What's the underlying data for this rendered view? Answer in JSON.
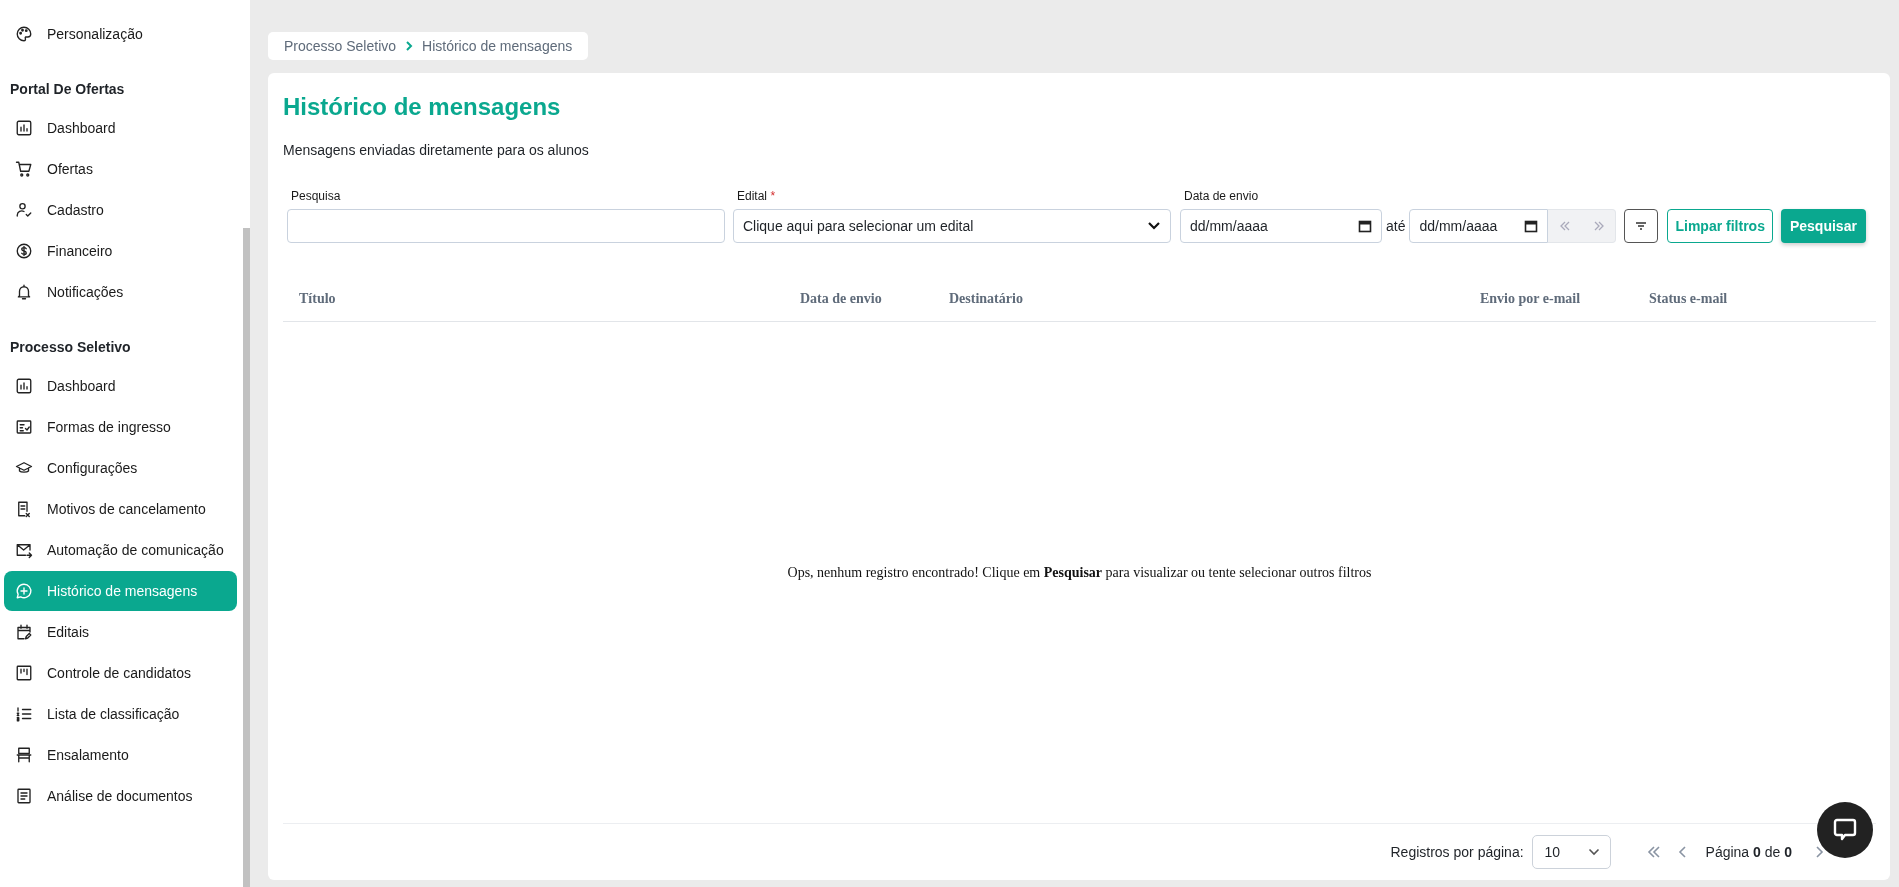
{
  "sidebar": {
    "sections": [
      {
        "items": [
          {
            "label": "Personalização",
            "selected": false
          }
        ]
      },
      {
        "title": "Portal De Ofertas",
        "items": [
          {
            "label": "Dashboard",
            "selected": false
          },
          {
            "label": "Ofertas",
            "selected": false
          },
          {
            "label": "Cadastro",
            "selected": false
          },
          {
            "label": "Financeiro",
            "selected": false
          },
          {
            "label": "Notificações",
            "selected": false
          }
        ]
      },
      {
        "title": "Processo Seletivo",
        "items": [
          {
            "label": "Dashboard",
            "selected": false
          },
          {
            "label": "Formas de ingresso",
            "selected": false
          },
          {
            "label": "Configurações",
            "selected": false
          },
          {
            "label": "Motivos de cancelamento",
            "selected": false
          },
          {
            "label": "Automação de comunicação",
            "selected": false
          },
          {
            "label": "Histórico de mensagens",
            "selected": true
          },
          {
            "label": "Editais",
            "selected": false
          },
          {
            "label": "Controle de candidatos",
            "selected": false
          },
          {
            "label": "Lista de classificação",
            "selected": false
          },
          {
            "label": "Ensalamento",
            "selected": false
          },
          {
            "label": "Análise de documentos",
            "selected": false
          }
        ]
      }
    ]
  },
  "breadcrumb": [
    "Processo Seletivo",
    "Histórico de mensagens"
  ],
  "page": {
    "title": "Histórico de mensagens",
    "subtitle": "Mensagens enviadas diretamente para os alunos"
  },
  "filters": {
    "search": {
      "label": "Pesquisa"
    },
    "edital": {
      "label": "Edital",
      "required_mark": "*",
      "placeholder": "Clique aqui para selecionar um edital"
    },
    "date": {
      "label": "Data de envio",
      "from_placeholder": "dd/mm/aaaa",
      "separator": "até",
      "to_placeholder": "dd/mm/aaaa"
    },
    "clear_button": "Limpar filtros",
    "search_button": "Pesquisar"
  },
  "table": {
    "columns": [
      "Título",
      "Data de envio",
      "Destinatário",
      "Envio por e-mail",
      "Status e-mail"
    ],
    "empty_message": "Ops, nenhum registro encontrado! Clique em **Pesquisar** para visualizar ou tente selecionar outros filtros"
  },
  "pagination": {
    "rows_label": "Registros por página:",
    "rows_per_page": "10",
    "page_text": "Página **0** de **0**"
  }
}
